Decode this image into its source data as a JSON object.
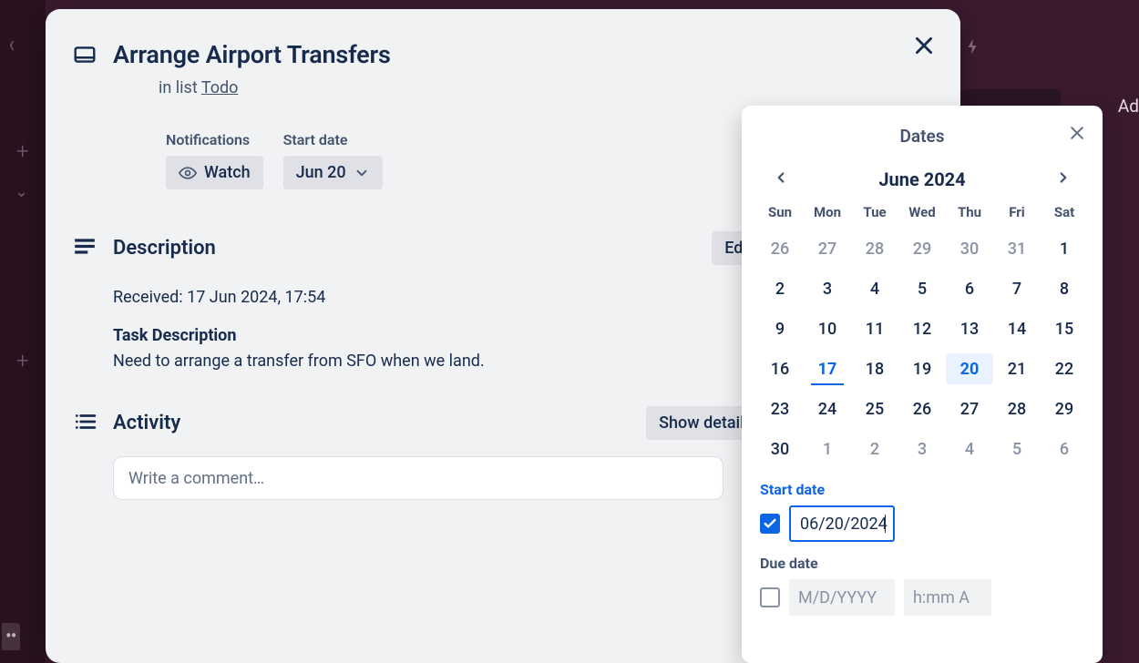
{
  "bg": {
    "add_text": "Ad"
  },
  "card": {
    "title": "Arrange Airport Transfers",
    "sub_prefix": "in list ",
    "list_name": "Todo",
    "notifications_label": "Notifications",
    "watch_label": "Watch",
    "startdate_label": "Start date",
    "startdate_value": "Jun 20",
    "description_label": "Description",
    "edit_label": "Edit",
    "desc_received": "Received: 17 Jun 2024, 17:54",
    "desc_heading": "Task Description",
    "desc_body": "Need to arrange a transfer from SFO when we land.",
    "activity_label": "Activity",
    "show_details_label": "Show details",
    "comment_placeholder": "Write a comment…"
  },
  "dates": {
    "title": "Dates",
    "month": "June 2024",
    "dow": [
      "Sun",
      "Mon",
      "Tue",
      "Wed",
      "Thu",
      "Fri",
      "Sat"
    ],
    "grid": [
      {
        "d": 26,
        "other": true
      },
      {
        "d": 27,
        "other": true
      },
      {
        "d": 28,
        "other": true
      },
      {
        "d": 29,
        "other": true
      },
      {
        "d": 30,
        "other": true
      },
      {
        "d": 31,
        "other": true
      },
      {
        "d": 1
      },
      {
        "d": 2
      },
      {
        "d": 3
      },
      {
        "d": 4
      },
      {
        "d": 5
      },
      {
        "d": 6
      },
      {
        "d": 7
      },
      {
        "d": 8
      },
      {
        "d": 9
      },
      {
        "d": 10
      },
      {
        "d": 11
      },
      {
        "d": 12
      },
      {
        "d": 13
      },
      {
        "d": 14
      },
      {
        "d": 15
      },
      {
        "d": 16
      },
      {
        "d": 17,
        "today": true
      },
      {
        "d": 18
      },
      {
        "d": 19
      },
      {
        "d": 20,
        "selected": true
      },
      {
        "d": 21
      },
      {
        "d": 22
      },
      {
        "d": 23
      },
      {
        "d": 24
      },
      {
        "d": 25
      },
      {
        "d": 26
      },
      {
        "d": 27
      },
      {
        "d": 28
      },
      {
        "d": 29
      },
      {
        "d": 30
      },
      {
        "d": 1,
        "other": true
      },
      {
        "d": 2,
        "other": true
      },
      {
        "d": 3,
        "other": true
      },
      {
        "d": 4,
        "other": true
      },
      {
        "d": 5,
        "other": true
      },
      {
        "d": 6,
        "other": true
      }
    ],
    "start_label": "Start date",
    "start_value": "06/20/2024",
    "start_checked": true,
    "due_label": "Due date",
    "due_date_placeholder": "M/D/YYYY",
    "due_time_placeholder": "h:mm A",
    "due_checked": false
  }
}
